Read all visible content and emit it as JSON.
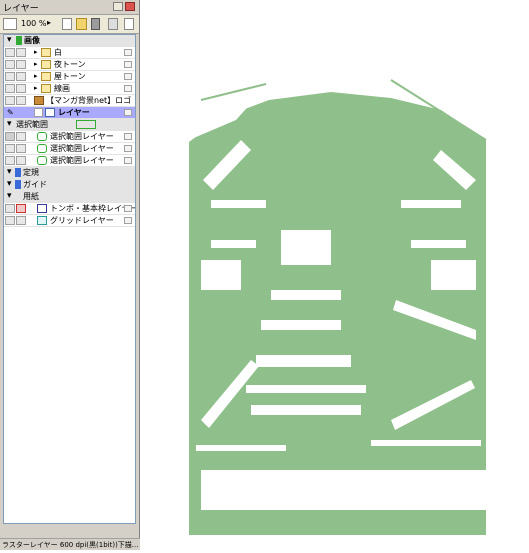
{
  "panel": {
    "title": "レイヤー",
    "zoom": "100 %",
    "status": "ラスターレイヤー 600 dpi(黒(1bit))下描..."
  },
  "folders": {
    "images": "画像",
    "selection": "選択範囲",
    "ruler": "定規",
    "guide": "ガイド",
    "paper": "用紙"
  },
  "layers": {
    "white": "白",
    "tone_night": "夜トーン",
    "tone_roof": "屋トーン",
    "lineart": "線画",
    "logo": "【マンガ背景net】ロゴ",
    "current": "レイヤー",
    "sel1": "選択範囲レイヤー",
    "sel2": "選択範囲レイヤー",
    "sel3": "選択範囲レイヤー",
    "trim": "トンボ・基本枠レイヤー",
    "grid": "グリッドレイヤー"
  },
  "colors": {
    "silhouette": "#8fbf8a",
    "selected_row": "#a9a9ff"
  }
}
